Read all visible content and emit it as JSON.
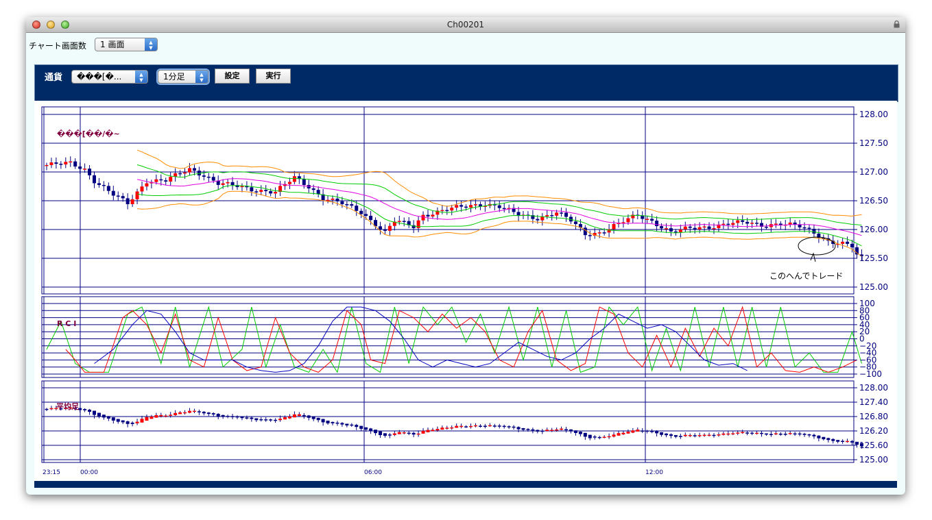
{
  "window": {
    "title": "Ch00201",
    "lock_icon": "lock-icon"
  },
  "topbar": {
    "label": "チャート画面数",
    "screens_select": "1 画面"
  },
  "toolbar": {
    "currency_label": "通貨",
    "currency_select": "���[�...",
    "interval_select": "1分足",
    "settings_button": "設定",
    "run_button": "実行"
  },
  "colors": {
    "navy": "#000080",
    "up": "#ff0000",
    "panel": "#002a66",
    "rci_short": "#00cc00",
    "rci_mid": "#ff0000",
    "rci_long": "#0000c0",
    "ma": "#e000e0",
    "band1": "#00cc00",
    "band2": "#ff8c00"
  },
  "price_panel": {
    "symbol_text": "���[��/�~",
    "y_ticks": [
      "128.00",
      "127.50",
      "127.00",
      "126.50",
      "126.00",
      "125.50",
      "125.00"
    ],
    "annotation": "このへんでトレード"
  },
  "rci_panel": {
    "title": "R C I",
    "y_ticks": [
      "100",
      "80",
      "60",
      "40",
      "20",
      "0",
      "−20",
      "−40",
      "−60",
      "−80",
      "−100"
    ]
  },
  "ha_panel": {
    "title": "平均足",
    "y_ticks": [
      "128.00",
      "127.40",
      "126.80",
      "126.20",
      "125.60",
      "125.00"
    ]
  },
  "time_axis": [
    "23:15",
    "00:00",
    "06:00",
    "12:00"
  ],
  "chart_data": {
    "type": "candlestick",
    "pair_label": "���[��/�~",
    "interval": "1分足",
    "price_axis": {
      "ylim": [
        125.0,
        128.0
      ],
      "ticks": [
        128.0,
        127.5,
        127.0,
        126.5,
        126.0,
        125.5,
        125.0
      ]
    },
    "time_labels": [
      "23:15",
      "00:00",
      "06:00",
      "12:00"
    ],
    "close_anchors": [
      [
        0,
        127.12
      ],
      [
        5,
        127.15
      ],
      [
        8,
        127.05
      ],
      [
        10,
        126.85
      ],
      [
        14,
        126.6
      ],
      [
        17,
        126.45
      ],
      [
        19,
        126.65
      ],
      [
        21,
        126.85
      ],
      [
        25,
        126.85
      ],
      [
        30,
        127.05
      ],
      [
        33,
        126.95
      ],
      [
        36,
        126.8
      ],
      [
        40,
        126.75
      ],
      [
        43,
        126.7
      ],
      [
        48,
        126.65
      ],
      [
        52,
        126.9
      ],
      [
        55,
        126.75
      ],
      [
        58,
        126.55
      ],
      [
        62,
        126.45
      ],
      [
        66,
        126.3
      ],
      [
        69,
        126.1
      ],
      [
        71,
        125.95
      ],
      [
        73,
        126.15
      ],
      [
        77,
        126.05
      ],
      [
        79,
        126.25
      ],
      [
        84,
        126.35
      ],
      [
        88,
        126.4
      ],
      [
        92,
        126.45
      ],
      [
        95,
        126.4
      ],
      [
        99,
        126.25
      ],
      [
        103,
        126.2
      ],
      [
        107,
        126.3
      ],
      [
        110,
        126.15
      ],
      [
        113,
        125.92
      ],
      [
        116,
        125.95
      ],
      [
        120,
        126.1
      ],
      [
        124,
        126.25
      ],
      [
        127,
        126.15
      ],
      [
        131,
        125.95
      ],
      [
        135,
        126.02
      ],
      [
        139,
        126.05
      ],
      [
        143,
        126.1
      ],
      [
        147,
        126.12
      ],
      [
        150,
        126.08
      ],
      [
        154,
        126.1
      ],
      [
        158,
        126.05
      ],
      [
        161,
        125.95
      ],
      [
        164,
        125.8
      ],
      [
        167,
        125.75
      ],
      [
        169,
        125.7
      ],
      [
        170,
        125.55
      ],
      [
        171,
        125.5
      ]
    ],
    "rci": {
      "ylim": [
        -100,
        100
      ],
      "series": [
        {
          "name": "",
          "color": "#00cc00",
          "anchors": [
            [
              0,
              -30
            ],
            [
              3,
              50
            ],
            [
              6,
              -70
            ],
            [
              9,
              -95
            ],
            [
              13,
              -95
            ],
            [
              17,
              70
            ],
            [
              20,
              90
            ],
            [
              24,
              -70
            ],
            [
              27,
              90
            ],
            [
              30,
              -80
            ],
            [
              34,
              90
            ],
            [
              37,
              -80
            ],
            [
              41,
              -30
            ],
            [
              43,
              90
            ],
            [
              46,
              -80
            ],
            [
              49,
              40
            ],
            [
              52,
              -80
            ],
            [
              55,
              -95
            ],
            [
              58,
              -30
            ],
            [
              61,
              -95
            ],
            [
              64,
              90
            ],
            [
              67,
              -70
            ],
            [
              70,
              -95
            ],
            [
              73,
              90
            ],
            [
              76,
              -70
            ],
            [
              79,
              90
            ],
            [
              82,
              40
            ],
            [
              85,
              90
            ],
            [
              88,
              -10
            ],
            [
              91,
              70
            ],
            [
              94,
              -40
            ],
            [
              97,
              90
            ],
            [
              100,
              -60
            ],
            [
              103,
              90
            ],
            [
              106,
              -80
            ],
            [
              109,
              80
            ],
            [
              112,
              -95
            ],
            [
              115,
              -80
            ],
            [
              118,
              90
            ],
            [
              121,
              40
            ],
            [
              124,
              90
            ],
            [
              127,
              -90
            ],
            [
              130,
              30
            ],
            [
              133,
              -90
            ],
            [
              136,
              90
            ],
            [
              139,
              -80
            ],
            [
              142,
              90
            ],
            [
              145,
              -80
            ],
            [
              148,
              90
            ],
            [
              151,
              -80
            ],
            [
              154,
              90
            ],
            [
              157,
              -80
            ],
            [
              160,
              -40
            ],
            [
              163,
              -95
            ],
            [
              166,
              -95
            ],
            [
              169,
              20
            ],
            [
              171,
              -70
            ]
          ]
        },
        {
          "name": "",
          "color": "#ff0000",
          "anchors": [
            [
              4,
              -30
            ],
            [
              6,
              -60
            ],
            [
              8,
              -95
            ],
            [
              12,
              -95
            ],
            [
              16,
              60
            ],
            [
              18,
              80
            ],
            [
              21,
              40
            ],
            [
              24,
              -40
            ],
            [
              27,
              70
            ],
            [
              30,
              -60
            ],
            [
              33,
              -80
            ],
            [
              36,
              60
            ],
            [
              39,
              -60
            ],
            [
              42,
              -90
            ],
            [
              45,
              -80
            ],
            [
              48,
              60
            ],
            [
              51,
              -40
            ],
            [
              54,
              -80
            ],
            [
              57,
              -95
            ],
            [
              60,
              -60
            ],
            [
              63,
              80
            ],
            [
              66,
              40
            ],
            [
              68,
              -60
            ],
            [
              71,
              -70
            ],
            [
              74,
              80
            ],
            [
              77,
              60
            ],
            [
              80,
              20
            ],
            [
              83,
              70
            ],
            [
              86,
              30
            ],
            [
              89,
              60
            ],
            [
              92,
              20
            ],
            [
              95,
              -60
            ],
            [
              98,
              -80
            ],
            [
              101,
              20
            ],
            [
              104,
              80
            ],
            [
              107,
              -60
            ],
            [
              110,
              -90
            ],
            [
              113,
              -70
            ],
            [
              116,
              90
            ],
            [
              119,
              70
            ],
            [
              122,
              -40
            ],
            [
              125,
              -80
            ],
            [
              128,
              10
            ],
            [
              131,
              -80
            ],
            [
              134,
              30
            ],
            [
              137,
              -50
            ],
            [
              140,
              30
            ],
            [
              143,
              -20
            ],
            [
              146,
              90
            ],
            [
              149,
              -80
            ],
            [
              152,
              -40
            ],
            [
              155,
              -90
            ],
            [
              158,
              -95
            ],
            [
              161,
              -80
            ],
            [
              164,
              -95
            ],
            [
              167,
              -80
            ],
            [
              170,
              -60
            ]
          ]
        },
        {
          "name": "",
          "color": "#0000c0",
          "anchors": [
            [
              10,
              -70
            ],
            [
              14,
              -30
            ],
            [
              18,
              40
            ],
            [
              21,
              80
            ],
            [
              24,
              70
            ],
            [
              27,
              20
            ],
            [
              30,
              -40
            ],
            [
              33,
              -60
            ],
            [
              36,
              -60
            ],
            [
              39,
              -60
            ],
            [
              42,
              -80
            ],
            [
              45,
              -90
            ],
            [
              48,
              -95
            ],
            [
              51,
              -90
            ],
            [
              54,
              -70
            ],
            [
              57,
              -20
            ],
            [
              60,
              50
            ],
            [
              63,
              90
            ],
            [
              66,
              90
            ],
            [
              69,
              80
            ],
            [
              72,
              50
            ],
            [
              75,
              0
            ],
            [
              78,
              -60
            ],
            [
              81,
              -80
            ],
            [
              84,
              -60
            ],
            [
              87,
              -70
            ],
            [
              90,
              -80
            ],
            [
              93,
              -70
            ],
            [
              96,
              -40
            ],
            [
              99,
              -10
            ],
            [
              102,
              -30
            ],
            [
              105,
              -50
            ],
            [
              108,
              -60
            ],
            [
              111,
              -40
            ],
            [
              114,
              0
            ],
            [
              117,
              30
            ],
            [
              120,
              70
            ],
            [
              123,
              50
            ],
            [
              126,
              30
            ],
            [
              129,
              40
            ],
            [
              132,
              20
            ],
            [
              135,
              -20
            ],
            [
              138,
              -60
            ],
            [
              141,
              -75
            ],
            [
              144,
              -70
            ],
            [
              147,
              -90
            ]
          ]
        }
      ]
    },
    "heikin_ashi": {
      "ylim": [
        125.0,
        128.0
      ],
      "ticks": [
        128.0,
        127.4,
        126.8,
        126.2,
        125.6,
        125.0
      ]
    }
  }
}
